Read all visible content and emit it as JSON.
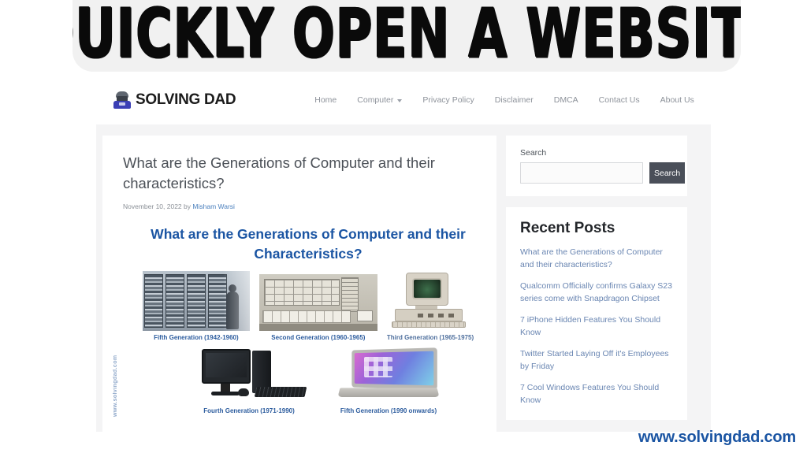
{
  "banner": {
    "title": "Quickly open a website"
  },
  "site": {
    "brand": {
      "logo_icon": "hacker-emoji-icon",
      "name": "SOLVING DAD"
    },
    "nav": [
      {
        "label": "Home",
        "has_dropdown": false
      },
      {
        "label": "Computer",
        "has_dropdown": true
      },
      {
        "label": "Privacy Policy",
        "has_dropdown": false
      },
      {
        "label": "Disclaimer",
        "has_dropdown": false
      },
      {
        "label": "DMCA",
        "has_dropdown": false
      },
      {
        "label": "Contact Us",
        "has_dropdown": false
      },
      {
        "label": "About Us",
        "has_dropdown": false
      }
    ],
    "post": {
      "title": "What are the Generations of Computer and their characteristics?",
      "date": "November 10, 2022",
      "by_word": "by",
      "author": "Misham Warsi"
    },
    "infographic": {
      "title": "What are the Generations of Computer and their Characteristics?",
      "watermark": "www.solvingdad.com",
      "row1": [
        {
          "caption": "Fifth Generation (1942-1960)",
          "image": "vacuum-tube-racks-photo"
        },
        {
          "caption": "Second Generation (1960-1965)",
          "image": "transistor-mainframe-photo"
        },
        {
          "caption": "Third Generation (1965-1975)",
          "image": "beige-desktop-crt-photo"
        }
      ],
      "row2": [
        {
          "caption": "Fourth Generation (1971-1990)",
          "image": "lcd-desktop-tower-photo"
        },
        {
          "caption": "Fifth Generation (1990 onwards)",
          "image": "modern-laptop-photo"
        }
      ]
    },
    "sidebar": {
      "search": {
        "label": "Search",
        "value": "",
        "placeholder": "",
        "button_label": "Search"
      },
      "recent_posts": {
        "title": "Recent Posts",
        "items": [
          "What are the Generations of Computer and their characteristics?",
          "Qualcomm Officially confirms Galaxy S23 series come with Snapdragon Chipset",
          "7 iPhone Hidden Features You Should Know",
          "Twitter Started Laying Off it's Employees by Friday",
          "7 Cool Windows Features You Should Know"
        ]
      }
    }
  },
  "footer": {
    "url": "www.solvingdad.com"
  },
  "colors": {
    "banner_bg": "#f1f1f1",
    "brand_blue": "#1b55a3",
    "link_blue": "#6a86b2",
    "button_dark": "#4a4f59",
    "page_bg": "#f4f4f5"
  }
}
